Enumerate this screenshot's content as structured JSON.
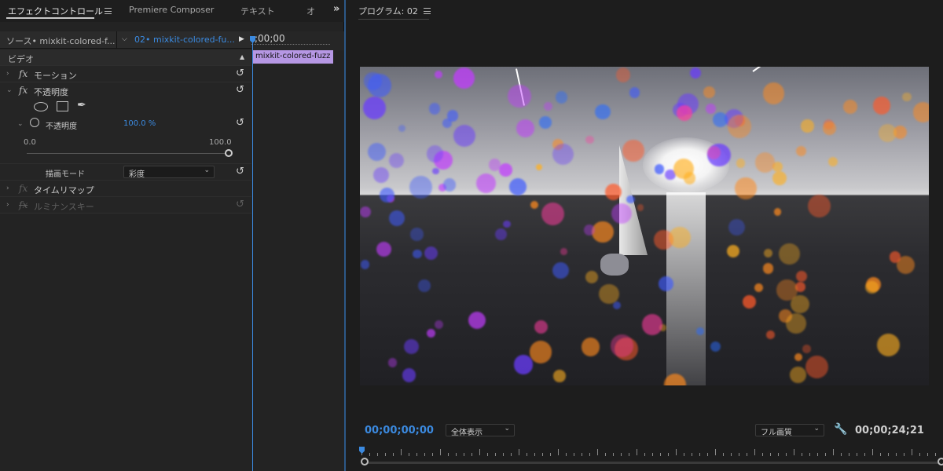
{
  "left_panel": {
    "tabs": [
      {
        "label": "エフェクトコントロール"
      },
      {
        "label": "Premiere Composer"
      },
      {
        "label": "テキスト"
      },
      {
        "label": "オ"
      }
    ],
    "overflow_icon": "double-chevron-right-icon",
    "source_label": "ソース• mixkit-colored-f...",
    "sequence_label": "02• mixkit-colored-fu...",
    "timeline_time": ";00;00",
    "clip_label": "mixkit-colored-fuzz",
    "video_section": "ビデオ",
    "effects": [
      {
        "label": "モーション"
      },
      {
        "label": "不透明度"
      }
    ],
    "opacity": {
      "label": "不透明度",
      "value": "100.0 %",
      "min": "0.0",
      "max": "100.0",
      "level": 1.0
    },
    "blend_mode": {
      "label": "描画モード",
      "value": "彩度"
    },
    "time_remap": "タイムリマップ",
    "luma_key": "ルミナンスキー"
  },
  "right_panel": {
    "title": "プログラム: 02",
    "current_time": "00;00;00;00",
    "zoom": "全体表示",
    "quality": "フル画質",
    "duration": "00;00;24;21"
  },
  "colors": {
    "accent_blue": "#3b8ae0",
    "clip_purple": "#b697e4",
    "timecode_blue": "#3b8ae0"
  }
}
